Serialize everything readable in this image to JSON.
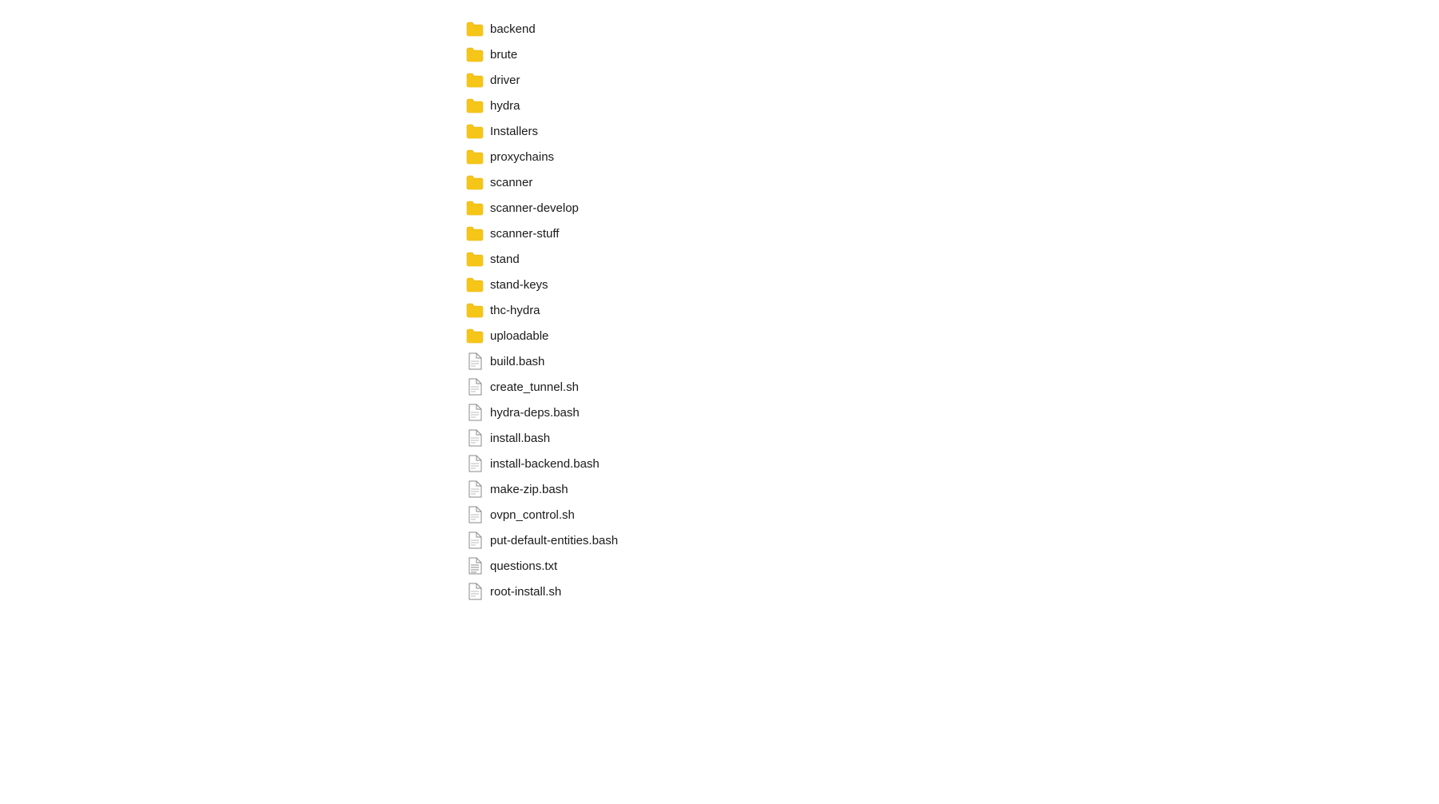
{
  "colors": {
    "folder": "#F5C518",
    "folder_shadow": "#E0A800",
    "file_border": "#888888",
    "file_lines": "#aaaaaa",
    "text_lines": "#888888"
  },
  "items": [
    {
      "type": "folder",
      "name": "backend"
    },
    {
      "type": "folder",
      "name": "brute"
    },
    {
      "type": "folder",
      "name": "driver"
    },
    {
      "type": "folder",
      "name": "hydra"
    },
    {
      "type": "folder",
      "name": "Installers"
    },
    {
      "type": "folder",
      "name": "proxychains"
    },
    {
      "type": "folder",
      "name": "scanner"
    },
    {
      "type": "folder",
      "name": "scanner-develop"
    },
    {
      "type": "folder",
      "name": "scanner-stuff"
    },
    {
      "type": "folder",
      "name": "stand"
    },
    {
      "type": "folder",
      "name": "stand-keys"
    },
    {
      "type": "folder",
      "name": "thc-hydra"
    },
    {
      "type": "folder",
      "name": "uploadable"
    },
    {
      "type": "file",
      "name": "build.bash"
    },
    {
      "type": "file",
      "name": "create_tunnel.sh"
    },
    {
      "type": "file",
      "name": "hydra-deps.bash"
    },
    {
      "type": "file",
      "name": "install.bash"
    },
    {
      "type": "file",
      "name": "install-backend.bash"
    },
    {
      "type": "file",
      "name": "make-zip.bash"
    },
    {
      "type": "file",
      "name": "ovpn_control.sh"
    },
    {
      "type": "file",
      "name": "put-default-entities.bash"
    },
    {
      "type": "file_text",
      "name": "questions.txt"
    },
    {
      "type": "file",
      "name": "root-install.sh"
    }
  ]
}
